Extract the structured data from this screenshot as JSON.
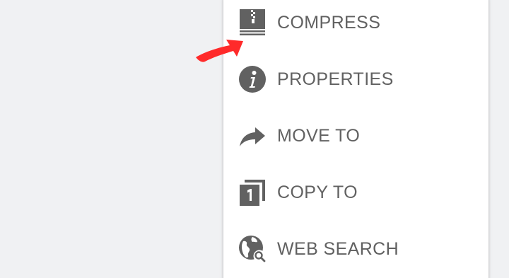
{
  "menu": {
    "items": [
      {
        "label": "COMPRESS",
        "icon": "archive-zip-icon"
      },
      {
        "label": "PROPERTIES",
        "icon": "info-icon"
      },
      {
        "label": "MOVE TO",
        "icon": "forward-arrow-icon"
      },
      {
        "label": "COPY TO",
        "icon": "copy-pages-icon"
      },
      {
        "label": "WEB SEARCH",
        "icon": "globe-search-icon"
      }
    ]
  },
  "annotation": {
    "arrow_color": "#ff2a2a",
    "points_to": "COMPRESS"
  },
  "colors": {
    "background": "#f0f1f3",
    "menu_background": "#ffffff",
    "icon_color": "#616161",
    "text_color": "#616161"
  }
}
